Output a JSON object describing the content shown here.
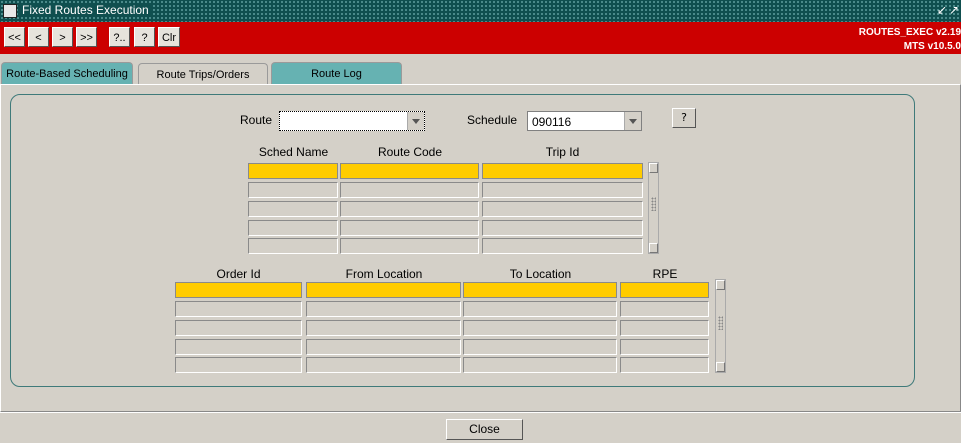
{
  "window": {
    "title": "Fixed Routes Execution",
    "controls": [
      "↙",
      "↗"
    ]
  },
  "toolbar": {
    "buttons": [
      "<<",
      "<",
      ">",
      ">>",
      "?..",
      "?",
      "Clr"
    ]
  },
  "version": {
    "line1": "ROUTES_EXEC v2.19",
    "line2": "MTS v10.5.0"
  },
  "tabs": [
    {
      "label": "Route-Based Scheduling",
      "active": false
    },
    {
      "label": "Route Trips/Orders",
      "active": true
    },
    {
      "label": "Route Log",
      "active": false
    }
  ],
  "filters": {
    "route_label": "Route",
    "route_value": "",
    "schedule_label": "Schedule",
    "schedule_value": "090116",
    "help_button": "?"
  },
  "trips_table": {
    "columns": [
      "Sched Name",
      "Route Code",
      "Trip Id"
    ],
    "rows": 5
  },
  "orders_table": {
    "columns": [
      "Order Id",
      "From Location",
      "To Location",
      "RPE"
    ],
    "rows": 5
  },
  "footer": {
    "close_label": "Close"
  },
  "colors": {
    "toolbar_red": "#cc0000",
    "selected_row": "#ffcc00",
    "tab_teal": "#66b2b2",
    "titlebar": "#0f4f4f"
  }
}
